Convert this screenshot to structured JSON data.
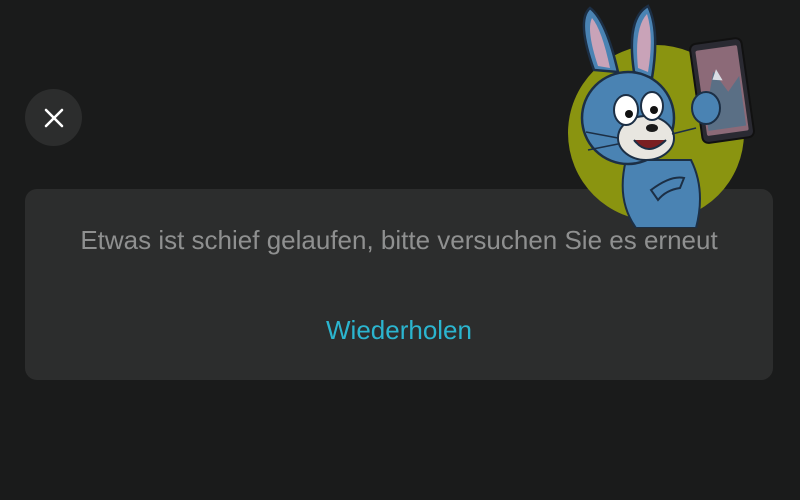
{
  "dialog": {
    "close_icon": "close-icon",
    "error_message": "Etwas ist schief gelaufen, bitte versuchen Sie es erneut",
    "retry_label": "Wiederholen"
  },
  "mascot": {
    "depicts": "rabbit-holding-phone"
  },
  "colors": {
    "background": "#1a1b1b",
    "card": "#2c2d2d",
    "message_text": "#8f9090",
    "link": "#2bb5cf",
    "mascot_circle": "#8a9410",
    "mascot_body": "#4a83b3"
  }
}
